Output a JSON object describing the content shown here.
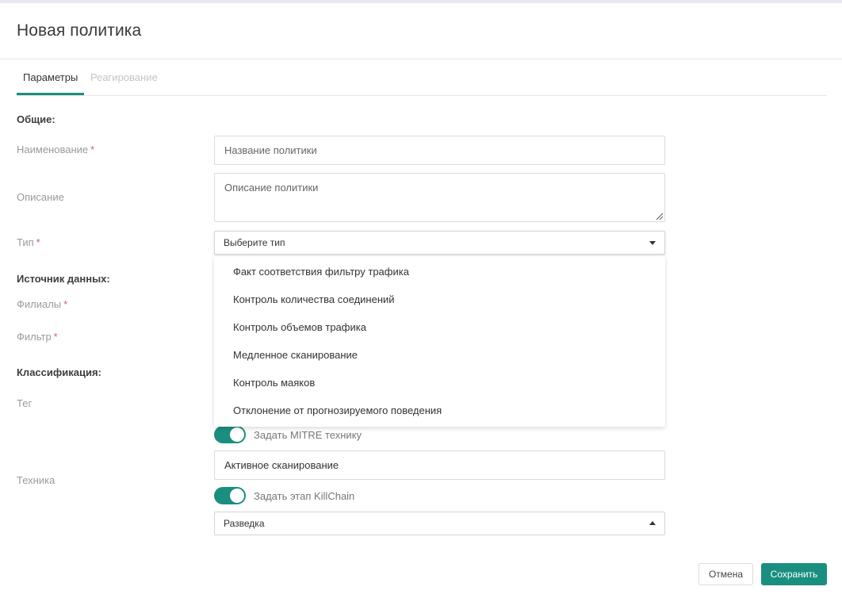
{
  "dialog": {
    "title": "Новая политика"
  },
  "tabs": [
    {
      "label": "Параметры",
      "active": true
    },
    {
      "label": "Реагирование",
      "active": false
    }
  ],
  "sections": {
    "general": "Общие:",
    "data_source": "Источник данных:",
    "classification": "Классификация:"
  },
  "fields": {
    "name": {
      "label": "Наименование",
      "required": "*",
      "placeholder": "Название политики",
      "value": ""
    },
    "description": {
      "label": "Описание",
      "placeholder": "Описание политики",
      "value": ""
    },
    "type": {
      "label": "Тип",
      "required": "*",
      "value": "Выберите тип"
    },
    "branches": {
      "label": "Филиалы",
      "required": "*"
    },
    "filter": {
      "label": "Фильтр",
      "required": "*"
    },
    "tag": {
      "label": "Тег"
    },
    "technique": {
      "label": "Техника"
    }
  },
  "type_options": [
    "Факт соответствия фильтру трафика",
    "Контроль количества соединений",
    "Контроль объемов трафика",
    "Медленное сканирование",
    "Контроль маяков",
    "Отклонение от прогнозируемого поведения"
  ],
  "mitre": {
    "toggle_label": "Задать MITRE технику",
    "enabled": true,
    "value": "Активное сканирование"
  },
  "killchain": {
    "toggle_label": "Задать этап KillChain",
    "enabled": true,
    "value": "Разведка"
  },
  "buttons": {
    "cancel": "Отмена",
    "save": "Сохранить"
  },
  "colors": {
    "accent": "#1a8f7f",
    "required": "#e05a5a"
  }
}
